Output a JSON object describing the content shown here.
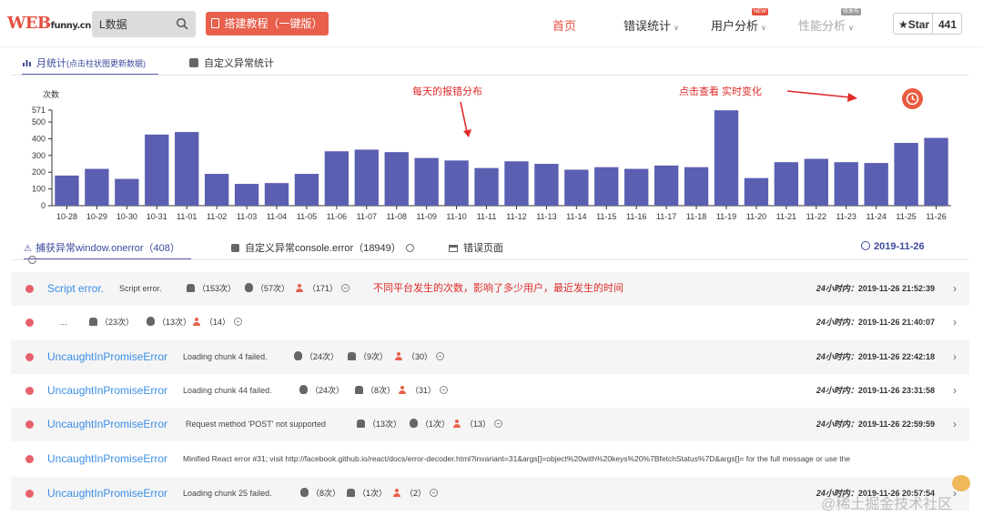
{
  "header": {
    "logo_main": "WEB",
    "logo_sub": "funny.cn",
    "search_value": "L数据",
    "build_button": "搭建教程（一键版）",
    "nav": [
      {
        "label": "首页",
        "state": "active"
      },
      {
        "label": "错误统计",
        "state": "normal"
      },
      {
        "label": "用户分析",
        "state": "normal",
        "badge": "NEW"
      },
      {
        "label": "性能分析",
        "state": "disabled",
        "badge": "待发布"
      }
    ],
    "star_label": "★Star",
    "star_count": "441"
  },
  "chart_tabs": {
    "monthly_label": "月统计",
    "monthly_note": "(点击柱状图更新数据)",
    "custom_label": "自定义异常统计"
  },
  "annotations": {
    "daily": "每天的报错分布",
    "realtime": "点击查看  实时变化",
    "row_note": "不同平台发生的次数，影响了多少用户，最近发生的时间"
  },
  "chart_data": {
    "type": "bar",
    "ylabel": "次数",
    "y_ticks": [
      0,
      100,
      200,
      300,
      400,
      500,
      571
    ],
    "ylim": [
      0,
      571
    ],
    "categories": [
      "10-28",
      "10-29",
      "10-30",
      "10-31",
      "11-01",
      "11-02",
      "11-03",
      "11-04",
      "11-05",
      "11-06",
      "11-07",
      "11-08",
      "11-09",
      "11-10",
      "11-11",
      "11-12",
      "11-13",
      "11-14",
      "11-15",
      "11-16",
      "11-17",
      "11-18",
      "11-19",
      "11-20",
      "11-21",
      "11-22",
      "11-23",
      "11-24",
      "11-25",
      "11-26"
    ],
    "values": [
      180,
      220,
      160,
      425,
      440,
      190,
      130,
      135,
      190,
      325,
      335,
      320,
      285,
      270,
      225,
      265,
      250,
      215,
      230,
      220,
      240,
      230,
      570,
      165,
      260,
      280,
      260,
      255,
      375,
      405
    ],
    "color": "#5b5fb1",
    "grid": false
  },
  "list_tabs": {
    "captured": "捕获异常window.onerror（408）",
    "custom": "自定义异常console.error（18949）",
    "error_page": "错误页面",
    "date": "2019-11-26"
  },
  "rows": [
    {
      "type": "Script error.",
      "message": "Script error.",
      "stats": [
        {
          "icon": "android-icon",
          "text": "（153次）"
        },
        {
          "icon": "apple-icon",
          "text": "（57次）"
        },
        {
          "icon": "user-icon",
          "text": "（171）"
        }
      ],
      "time_label": "24小时内：",
      "time": "2019-11-26 21:52:39"
    },
    {
      "type": "",
      "message": "...",
      "stats": [
        {
          "icon": "android-icon",
          "text": "（23次）"
        },
        {
          "icon": "apple-icon",
          "text": "（13次）"
        },
        {
          "icon": "user-icon",
          "text": "（14）"
        }
      ],
      "time_label": "24小时内：",
      "time": "2019-11-26 21:40:07"
    },
    {
      "type": "UncaughtInPromiseError",
      "message": "Loading chunk 4 failed.",
      "stats": [
        {
          "icon": "apple-icon",
          "text": "（24次）"
        },
        {
          "icon": "android-icon",
          "text": "（9次）"
        },
        {
          "icon": "user-icon",
          "text": "（30）"
        }
      ],
      "time_label": "24小时内：",
      "time": "2019-11-26 22:42:18"
    },
    {
      "type": "UncaughtInPromiseError",
      "message": "Loading chunk 44 failed.",
      "stats": [
        {
          "icon": "apple-icon",
          "text": "（24次）"
        },
        {
          "icon": "android-icon",
          "text": "（8次）"
        },
        {
          "icon": "user-icon",
          "text": "（31）"
        }
      ],
      "time_label": "24小时内：",
      "time": "2019-11-26 23:31:58"
    },
    {
      "type": "UncaughtInPromiseError",
      "message": "Request method 'POST' not supported",
      "stats": [
        {
          "icon": "android-icon",
          "text": "（13次）"
        },
        {
          "icon": "apple-icon",
          "text": "（1次）"
        },
        {
          "icon": "user-icon",
          "text": "（13）"
        }
      ],
      "time_label": "24小时内：",
      "time": "2019-11-26 22:59:59"
    },
    {
      "type": "UncaughtInPromiseError",
      "message": "Minified React error #31; visit http://facebook.github.io/react/docs/error-decoder.html?invariant=31&args[]=object%20with%20keys%20%7BfetchStatus%7D&args[]= for the full message or use the",
      "stats": [],
      "time_label": "",
      "time": ""
    },
    {
      "type": "UncaughtInPromiseError",
      "message": "Loading chunk 25 failed.",
      "stats": [
        {
          "icon": "apple-icon",
          "text": "（8次）"
        },
        {
          "icon": "android-icon",
          "text": "（1次）"
        },
        {
          "icon": "user-icon",
          "text": "（2）"
        }
      ],
      "time_label": "24小时内：",
      "time": "2019-11-26 20:57:54"
    }
  ],
  "watermark": "@稀土掘金技术社区"
}
